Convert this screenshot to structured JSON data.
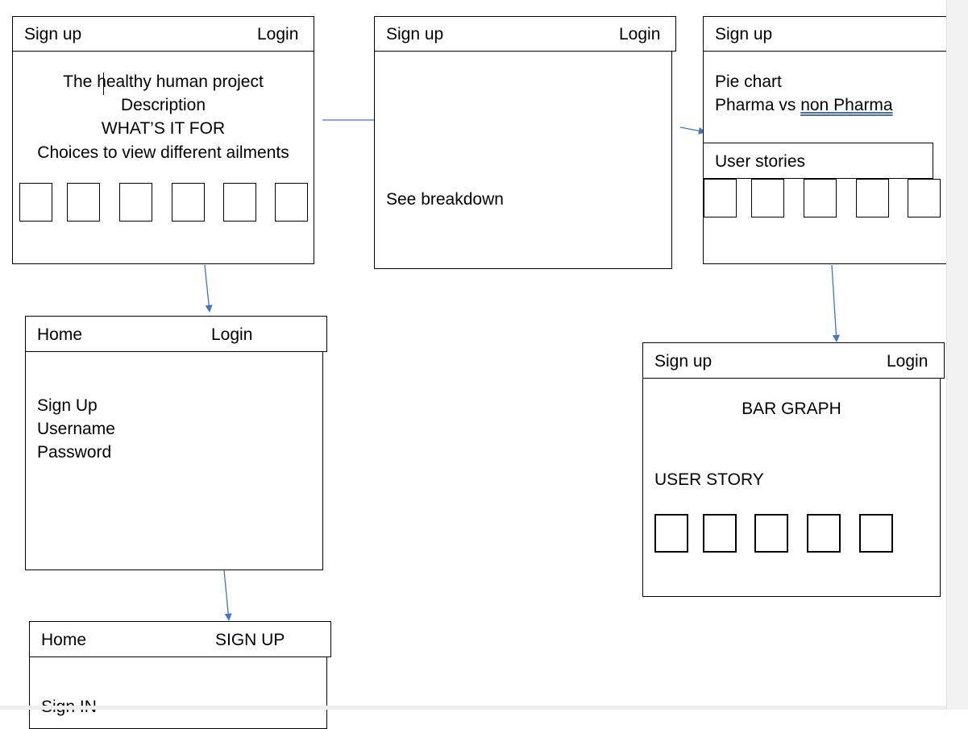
{
  "frames": {
    "home": {
      "nav_left": "Sign up",
      "nav_right": "Login",
      "title": "The healthy human project",
      "line2": "Description",
      "line3": "WHAT’S IT FOR",
      "line4": "Choices to view different ailments"
    },
    "breakdown": {
      "nav_left": "Sign up",
      "nav_right": "Login",
      "text": "See breakdown"
    },
    "pie": {
      "nav_left": "Sign up",
      "line1": "Pie chart",
      "line2_prefix": "Pharma vs ",
      "line2_underlined": "non Pharma",
      "section_label": "User stories"
    },
    "signup": {
      "nav_left": "Home",
      "nav_right": "Login",
      "line1": "Sign Up",
      "line2": "Username",
      "line3": "Password"
    },
    "bar": {
      "nav_left": "Sign up",
      "nav_right": "Login",
      "title": "BAR GRAPH",
      "subtitle": "USER STORY"
    },
    "signin": {
      "nav_left": "Home",
      "nav_right": "SIGN UP",
      "partial_text": "Sign IN"
    }
  },
  "colors": {
    "arrow": "#4472c4",
    "border": "#000000"
  }
}
